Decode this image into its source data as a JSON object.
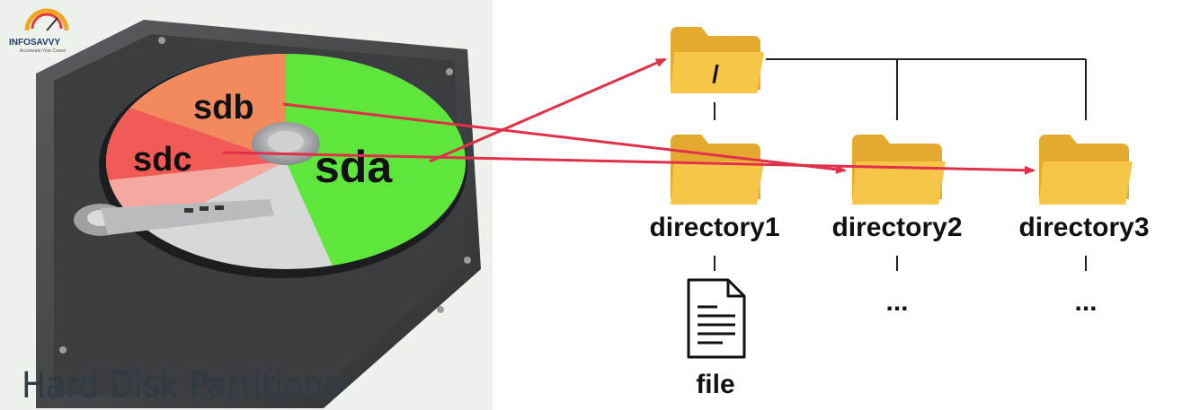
{
  "logo": {
    "brand": "INFOSAVVY",
    "tagline": "Accelerate Your Career"
  },
  "disk": {
    "caption": "Hard Disk Partitions",
    "partitions": [
      {
        "name": "sda",
        "color": "#5ee63c"
      },
      {
        "name": "sdb",
        "color": "#f28a5e"
      },
      {
        "name": "sdc",
        "color": "#f25a55"
      }
    ]
  },
  "tree": {
    "root": {
      "label": "/"
    },
    "directories": [
      {
        "label": "directory1"
      },
      {
        "label": "directory2"
      },
      {
        "label": "directory3"
      }
    ],
    "file": {
      "label": "file"
    },
    "ellipsis": [
      "...",
      "..."
    ]
  },
  "colors": {
    "arrow": "#e0304a",
    "folder": "#f7c548",
    "folder_back": "#e4a92f",
    "disk_bg": "#eef2ec"
  }
}
